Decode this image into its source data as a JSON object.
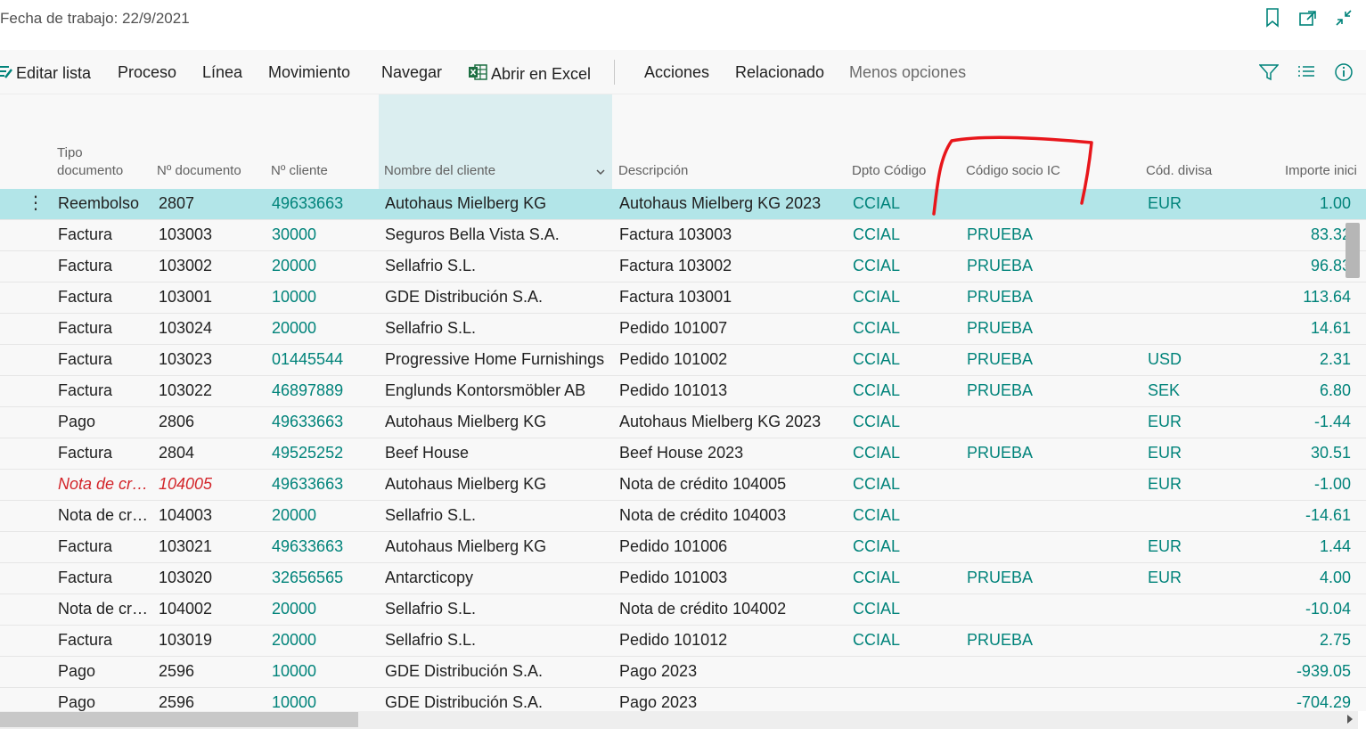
{
  "top": {
    "work_date": "Fecha de trabajo: 22/9/2021"
  },
  "actions": {
    "edit_list": "Editar lista",
    "process": "Proceso",
    "line": "Línea",
    "movement": "Movimiento",
    "navigate": "Navegar",
    "open_excel": "Abrir en Excel",
    "actions": "Acciones",
    "related": "Relacionado",
    "less_options": "Menos opciones"
  },
  "columns": {
    "tipo_line1": "Tipo",
    "tipo_line2": "documento",
    "ndoc": "Nº documento",
    "ncli": "Nº cliente",
    "nombre": "Nombre del cliente",
    "desc": "Descripción",
    "dpto": "Dpto Código",
    "ic": "Código socio IC",
    "divisa": "Cód. divisa",
    "importe": "Importe inici"
  },
  "rows": [
    {
      "tipo": "Reembolso",
      "ndoc": "2807",
      "ncli": "49633663",
      "nombre": "Autohaus Mielberg KG",
      "desc": "Autohaus Mielberg KG 2023",
      "dpto": "CCIAL",
      "ic": "",
      "divisa": "EUR",
      "importe": "1.00"
    },
    {
      "tipo": "Factura",
      "ndoc": "103003",
      "ncli": "30000",
      "nombre": "Seguros Bella Vista S.A.",
      "desc": "Factura 103003",
      "dpto": "CCIAL",
      "ic": "PRUEBA",
      "divisa": "",
      "importe": "83.32"
    },
    {
      "tipo": "Factura",
      "ndoc": "103002",
      "ncli": "20000",
      "nombre": "Sellafrio S.L.",
      "desc": "Factura 103002",
      "dpto": "CCIAL",
      "ic": "PRUEBA",
      "divisa": "",
      "importe": "96.83"
    },
    {
      "tipo": "Factura",
      "ndoc": "103001",
      "ncli": "10000",
      "nombre": "GDE Distribución S.A.",
      "desc": "Factura 103001",
      "dpto": "CCIAL",
      "ic": "PRUEBA",
      "divisa": "",
      "importe": "113.64"
    },
    {
      "tipo": "Factura",
      "ndoc": "103024",
      "ncli": "20000",
      "nombre": "Sellafrio S.L.",
      "desc": "Pedido 101007",
      "dpto": "CCIAL",
      "ic": "PRUEBA",
      "divisa": "",
      "importe": "14.61"
    },
    {
      "tipo": "Factura",
      "ndoc": "103023",
      "ncli": "01445544",
      "nombre": "Progressive Home Furnishings",
      "desc": "Pedido 101002",
      "dpto": "CCIAL",
      "ic": "PRUEBA",
      "divisa": "USD",
      "importe": "2.31"
    },
    {
      "tipo": "Factura",
      "ndoc": "103022",
      "ncli": "46897889",
      "nombre": "Englunds Kontorsmöbler AB",
      "desc": "Pedido 101013",
      "dpto": "CCIAL",
      "ic": "PRUEBA",
      "divisa": "SEK",
      "importe": "6.80"
    },
    {
      "tipo": "Pago",
      "ndoc": "2806",
      "ncli": "49633663",
      "nombre": "Autohaus Mielberg KG",
      "desc": "Autohaus Mielberg KG 2023",
      "dpto": "CCIAL",
      "ic": "",
      "divisa": "EUR",
      "importe": "-1.44"
    },
    {
      "tipo": "Factura",
      "ndoc": "2804",
      "ncli": "49525252",
      "nombre": "Beef House",
      "desc": "Beef House 2023",
      "dpto": "CCIAL",
      "ic": "PRUEBA",
      "divisa": "EUR",
      "importe": "30.51"
    },
    {
      "tipo": "Nota de crédito",
      "ndoc": "104005",
      "ncli": "49633663",
      "nombre": "Autohaus Mielberg KG",
      "desc": "Nota de crédito 104005",
      "dpto": "CCIAL",
      "ic": "",
      "divisa": "EUR",
      "importe": "-1.00"
    },
    {
      "tipo": "Nota de crédito",
      "ndoc": "104003",
      "ncli": "20000",
      "nombre": "Sellafrio S.L.",
      "desc": "Nota de crédito 104003",
      "dpto": "CCIAL",
      "ic": "",
      "divisa": "",
      "importe": "-14.61"
    },
    {
      "tipo": "Factura",
      "ndoc": "103021",
      "ncli": "49633663",
      "nombre": "Autohaus Mielberg KG",
      "desc": "Pedido 101006",
      "dpto": "CCIAL",
      "ic": "",
      "divisa": "EUR",
      "importe": "1.44"
    },
    {
      "tipo": "Factura",
      "ndoc": "103020",
      "ncli": "32656565",
      "nombre": "Antarcticopy",
      "desc": "Pedido 101003",
      "dpto": "CCIAL",
      "ic": "PRUEBA",
      "divisa": "EUR",
      "importe": "4.00"
    },
    {
      "tipo": "Nota de crédito",
      "ndoc": "104002",
      "ncli": "20000",
      "nombre": "Sellafrio S.L.",
      "desc": "Nota de crédito 104002",
      "dpto": "CCIAL",
      "ic": "",
      "divisa": "",
      "importe": "-10.04"
    },
    {
      "tipo": "Factura",
      "ndoc": "103019",
      "ncli": "20000",
      "nombre": "Sellafrio S.L.",
      "desc": "Pedido 101012",
      "dpto": "CCIAL",
      "ic": "PRUEBA",
      "divisa": "",
      "importe": "2.75"
    },
    {
      "tipo": "Pago",
      "ndoc": "2596",
      "ncli": "10000",
      "nombre": "GDE Distribución S.A.",
      "desc": "Pago 2023",
      "dpto": "",
      "ic": "",
      "divisa": "",
      "importe": "-939.05"
    },
    {
      "tipo": "Pago",
      "ndoc": "2596",
      "ncli": "10000",
      "nombre": "GDE Distribución S.A.",
      "desc": "Pago 2023",
      "dpto": "",
      "ic": "",
      "divisa": "",
      "importe": "-704.29"
    }
  ],
  "colors": {
    "accent": "#00837a",
    "selected_row": "#b2e5e8",
    "error_red": "#d3262b",
    "annotation_red": "#e8161b"
  },
  "icons": [
    "bookmark-icon",
    "open-new-window-icon",
    "collapse-icon",
    "edit-list-icon",
    "excel-icon",
    "filter-icon",
    "list-view-icon",
    "info-icon",
    "more-options-icon",
    "chevron-down-icon"
  ]
}
